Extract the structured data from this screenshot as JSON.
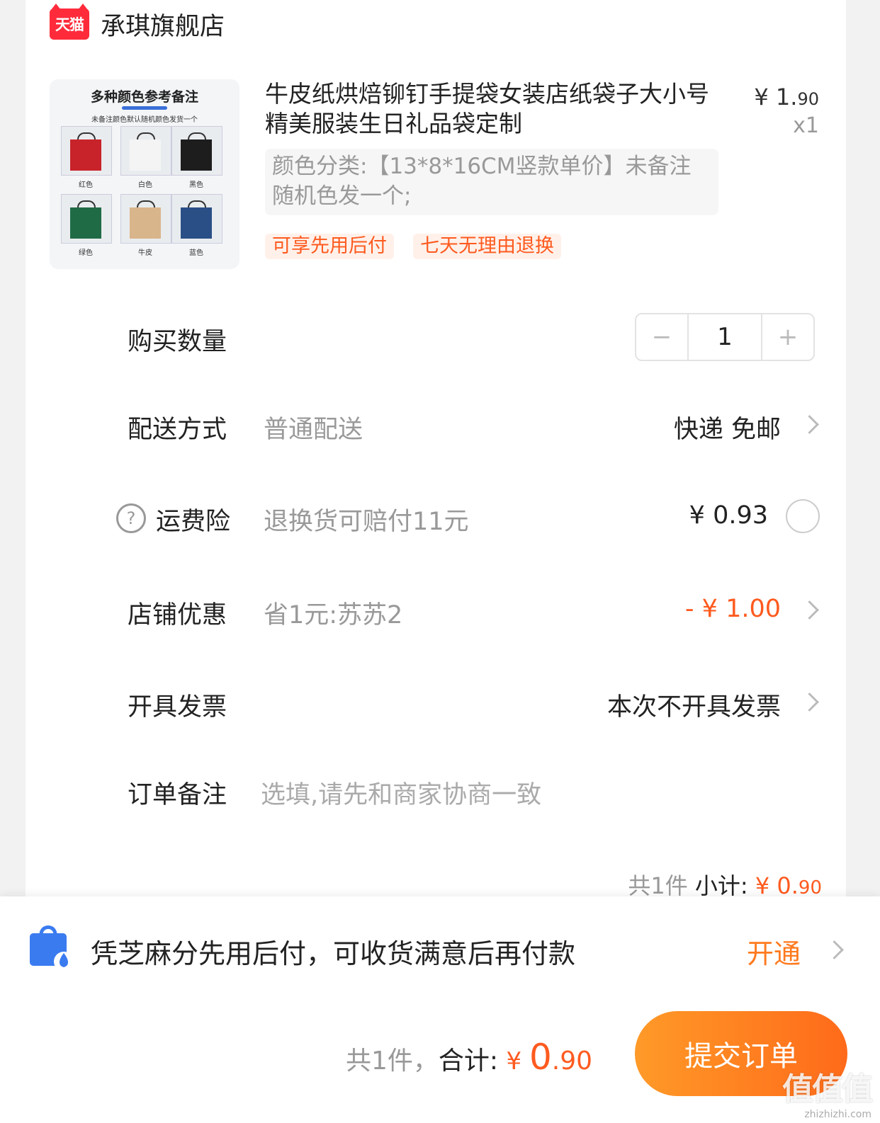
{
  "store": {
    "logo_text": "天猫",
    "name": "承琪旗舰店"
  },
  "product": {
    "thumb": {
      "title": "多种颜色参考备注",
      "subtitle": "未备注颜色默认随机颜色发货一个",
      "colors": [
        {
          "label": "红色",
          "hex": "#c8232a"
        },
        {
          "label": "白色",
          "hex": "#f4f4f4"
        },
        {
          "label": "黑色",
          "hex": "#1d1d1d"
        },
        {
          "label": "绿色",
          "hex": "#1f6b46"
        },
        {
          "label": "牛皮",
          "hex": "#d9b58b"
        },
        {
          "label": "蓝色",
          "hex": "#2a4f86"
        }
      ]
    },
    "title": "牛皮纸烘焙铆钉手提袋女装店纸袋子大小号精美服装生日礼品袋定制",
    "price_int": "¥ 1.",
    "price_dec": "90",
    "qty": "x1",
    "sku": "颜色分类:【13*8*16CM竖款单价】未备注随机色发一个;",
    "tags": [
      "可享先用后付",
      "七天无理由退换"
    ]
  },
  "rows": {
    "quantity": {
      "label": "购买数量",
      "minus": "−",
      "value": "1",
      "plus": "+"
    },
    "delivery": {
      "label": "配送方式",
      "sub": "普通配送",
      "value": "快递 免邮"
    },
    "insurance": {
      "label": "运费险",
      "help": "?",
      "sub": "退换货可赔付11元",
      "value": "¥ 0.93"
    },
    "discount": {
      "label": "店铺优惠",
      "sub": "省1元:苏苏2",
      "value": "- ¥ 1.00"
    },
    "invoice": {
      "label": "开具发票",
      "value": "本次不开具发票"
    },
    "note": {
      "label": "订单备注",
      "placeholder": "选填,请先和商家协商一致"
    }
  },
  "subtotal": {
    "count": "共1件 ",
    "label": "小计: ",
    "value_int": "¥ 0.",
    "value_dec": "90"
  },
  "bnpl": {
    "text": "凭芝麻分先用后付，可收货满意后再付款",
    "link": "开通"
  },
  "footer": {
    "count": "共1件，",
    "label": "合计: ",
    "currency": "¥ ",
    "big": "0",
    "dec": ".90",
    "submit": "提交订单"
  },
  "watermark": {
    "logo": "值值值",
    "url": "zhizhizhi.com"
  },
  "colors": {
    "accent": "#ff5a1f",
    "submit_start": "#ff9a28",
    "submit_end": "#ff6a1a",
    "tmall": "#ff2b3b"
  }
}
